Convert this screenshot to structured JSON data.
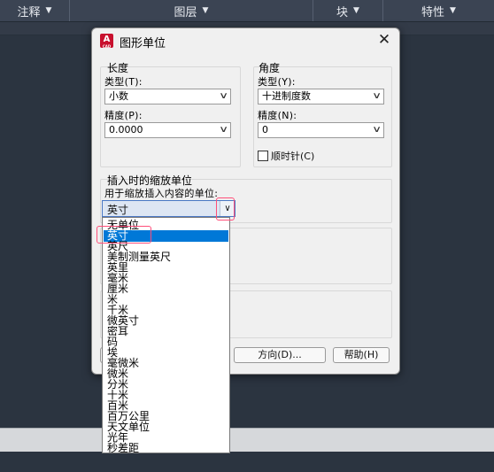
{
  "ribbon": {
    "panels": [
      {
        "label": "注释"
      },
      {
        "label": "图层"
      },
      {
        "label": "块"
      },
      {
        "label": "特性"
      }
    ]
  },
  "dialog": {
    "title": "图形单位",
    "app_icon_letter": "A",
    "app_icon_sub": "CAD",
    "length": {
      "group_label": "长度",
      "type_label": "类型(T):",
      "type_value": "小数",
      "precision_label": "精度(P):",
      "precision_value": "0.0000"
    },
    "angle": {
      "group_label": "角度",
      "type_label": "类型(Y):",
      "type_value": "十进制度数",
      "precision_label": "精度(N):",
      "precision_value": "0",
      "clockwise_label": "顺时针(C)"
    },
    "insertion": {
      "group_label": "插入时的缩放单位",
      "units_label": "用于缩放插入内容的单位:",
      "units_value": "英寸"
    },
    "buttons": {
      "direction": "方向(D)...",
      "help": "帮助(H)"
    },
    "unit_options": [
      "无单位",
      "英寸",
      "英尺",
      "美制测量英尺",
      "英里",
      "毫米",
      "厘米",
      "米",
      "千米",
      "微英寸",
      "密耳",
      "码",
      "埃",
      "毫微米",
      "微米",
      "分米",
      "十米",
      "百米",
      "百万公里",
      "天文单位",
      "光年",
      "秒差距"
    ],
    "selected_option": "英寸"
  },
  "colors": {
    "highlight": "#0078d7",
    "annotation": "#ff4f7a",
    "app_icon": "#c8102e"
  }
}
